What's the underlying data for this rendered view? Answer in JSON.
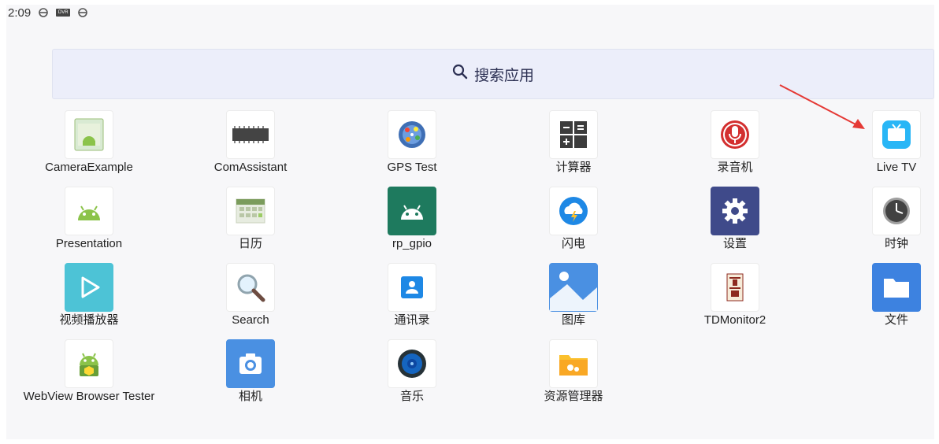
{
  "status_bar": {
    "time": "2:09",
    "icons": [
      "sim-icon",
      "dvr-icon",
      "sim-icon"
    ],
    "dvr_text": "DVR"
  },
  "search": {
    "label": "搜索应用",
    "icon": "search-icon"
  },
  "apps": [
    {
      "label": "CameraExample",
      "icon": "camera-example-icon"
    },
    {
      "label": "ComAssistant",
      "icon": "com-assistant-icon"
    },
    {
      "label": "GPS Test",
      "icon": "gps-test-icon"
    },
    {
      "label": "计算器",
      "icon": "calculator-icon"
    },
    {
      "label": "录音机",
      "icon": "recorder-icon"
    },
    {
      "label": "Live TV",
      "icon": "live-tv-icon"
    },
    {
      "label": "Presentation",
      "icon": "presentation-icon"
    },
    {
      "label": "日历",
      "icon": "calendar-icon"
    },
    {
      "label": "rp_gpio",
      "icon": "rp-gpio-icon"
    },
    {
      "label": "闪电",
      "icon": "lightning-icon"
    },
    {
      "label": "设置",
      "icon": "settings-icon"
    },
    {
      "label": "时钟",
      "icon": "clock-icon"
    },
    {
      "label": "视频播放器",
      "icon": "video-player-icon"
    },
    {
      "label": "Search",
      "icon": "search-app-icon"
    },
    {
      "label": "通讯录",
      "icon": "contacts-icon"
    },
    {
      "label": "图库",
      "icon": "gallery-icon"
    },
    {
      "label": "TDMonitor2",
      "icon": "tdmonitor-icon"
    },
    {
      "label": "文件",
      "icon": "files-icon"
    },
    {
      "label": "WebView Browser Tester",
      "icon": "webview-tester-icon"
    },
    {
      "label": "相机",
      "icon": "camera-icon"
    },
    {
      "label": "音乐",
      "icon": "music-icon"
    },
    {
      "label": "资源管理器",
      "icon": "file-manager-icon"
    }
  ],
  "annotation": {
    "type": "red-arrow",
    "points_to": "Live TV",
    "color": "#e53935"
  }
}
